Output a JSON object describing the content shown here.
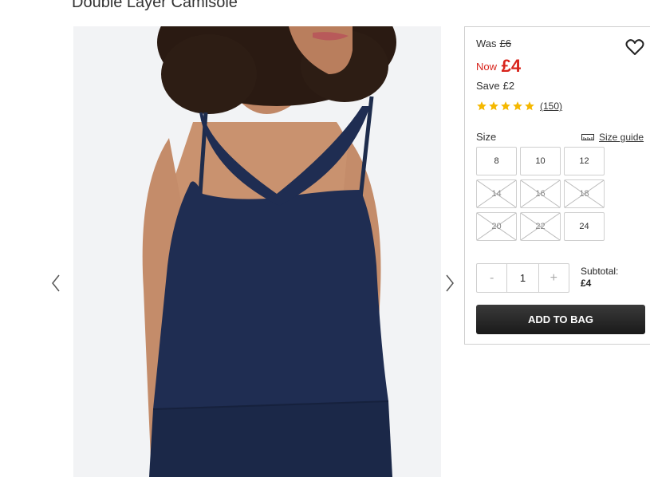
{
  "product": {
    "title": "Double Layer Camisole"
  },
  "gallery": {
    "image_name": "navy-camisole-photo"
  },
  "price": {
    "was_label": "Was",
    "was_value": "£6",
    "now_label": "Now",
    "now_value": "£4",
    "save_label": "Save",
    "save_value": "£2",
    "accent_color": "#d8241c"
  },
  "rating": {
    "stars": 5,
    "max": 5,
    "reviews": "(150)",
    "star_color": "#f5b800"
  },
  "size": {
    "label": "Size",
    "guide_label": "Size guide",
    "options": [
      {
        "value": "8",
        "available": true
      },
      {
        "value": "10",
        "available": true
      },
      {
        "value": "12",
        "available": true
      },
      {
        "value": "14",
        "available": false
      },
      {
        "value": "16",
        "available": false
      },
      {
        "value": "18",
        "available": false
      },
      {
        "value": "20",
        "available": false
      },
      {
        "value": "22",
        "available": false
      },
      {
        "value": "24",
        "available": true
      }
    ]
  },
  "quantity": {
    "minus": "-",
    "value": "1",
    "plus": "+"
  },
  "subtotal": {
    "label": "Subtotal:",
    "value": "£4"
  },
  "cta": {
    "add_to_bag": "ADD TO BAG"
  },
  "icons": {
    "wishlist": "heart-icon",
    "prev": "chevron-left-icon",
    "next": "chevron-right-icon",
    "guide": "ruler-icon"
  }
}
